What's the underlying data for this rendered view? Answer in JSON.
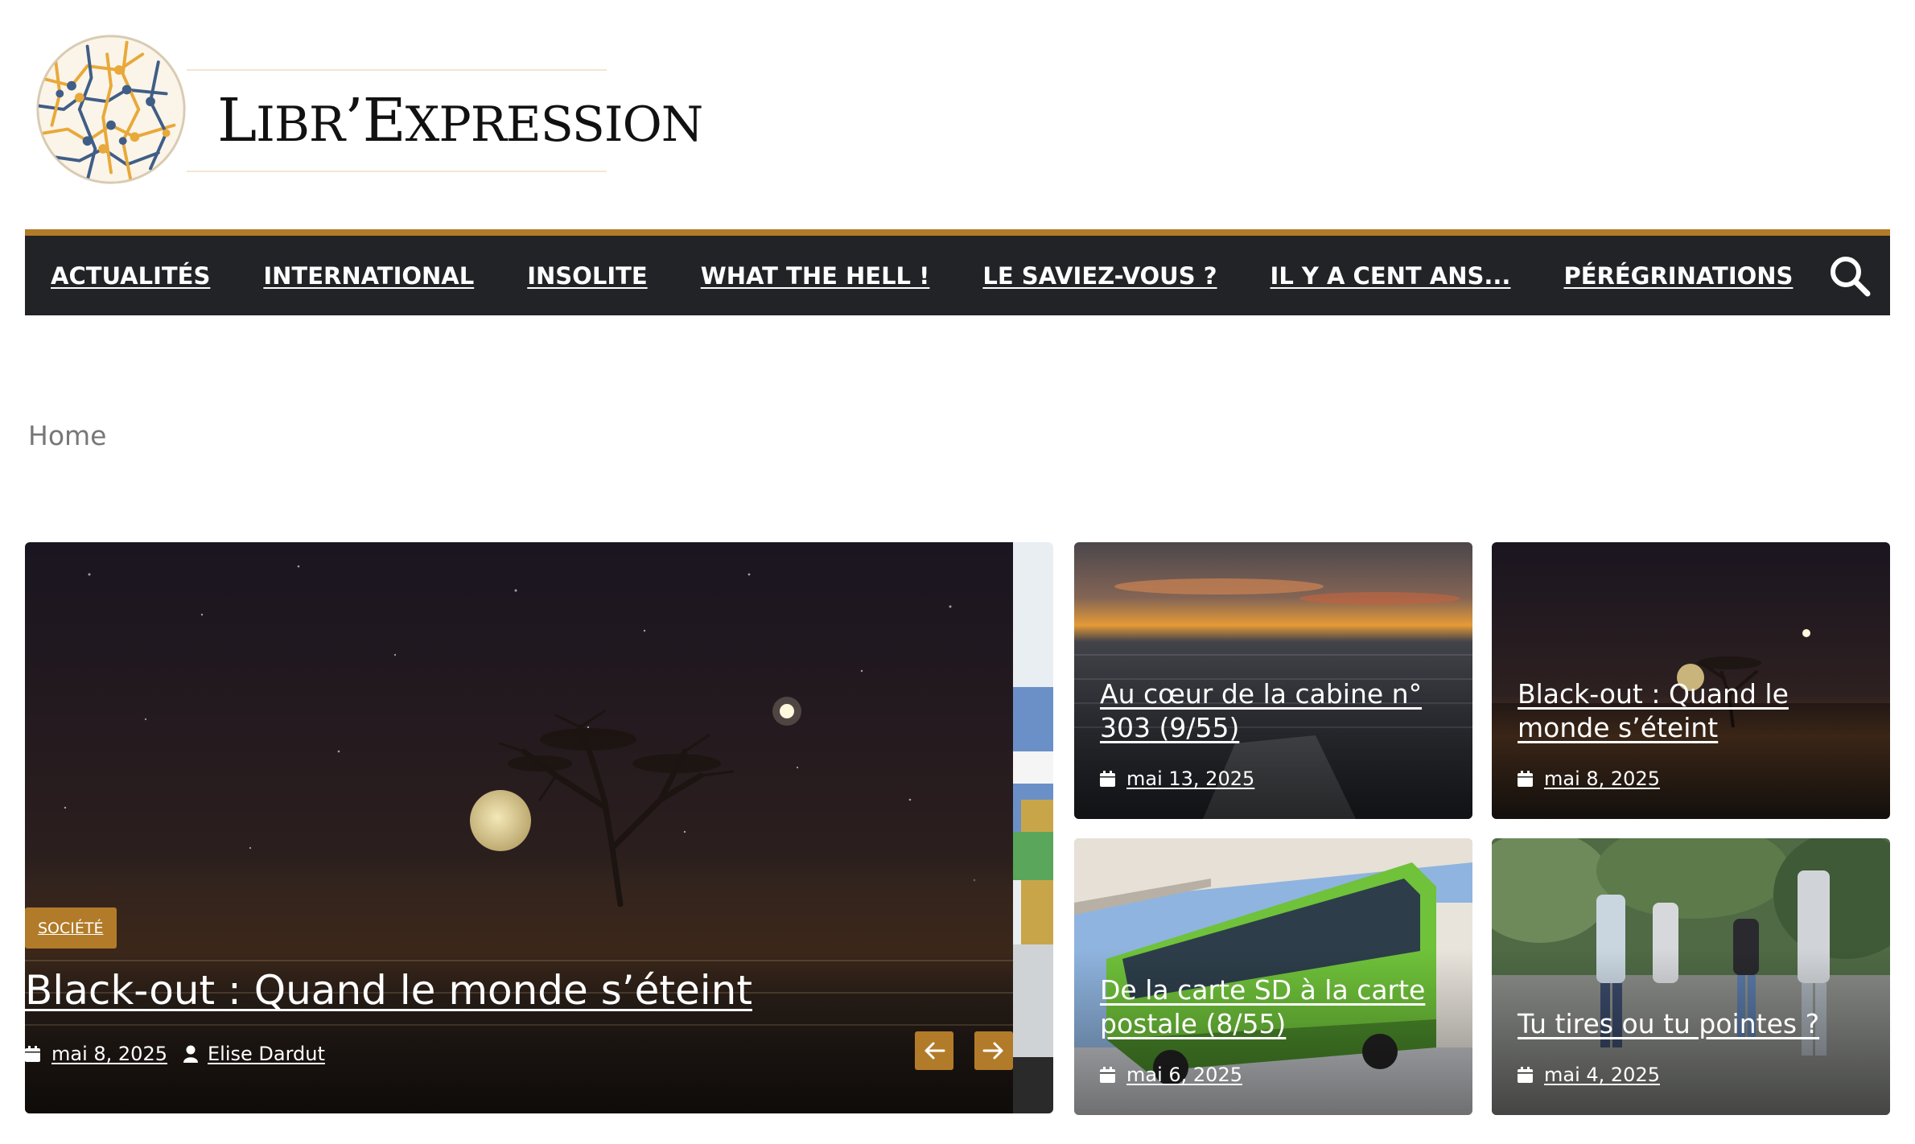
{
  "site": {
    "logo_text": "Libr’Expression",
    "brand_color": "#b27b29",
    "nav_bg": "#222327"
  },
  "nav": {
    "items": [
      {
        "label": "ACTUALITÉS"
      },
      {
        "label": "INTERNATIONAL"
      },
      {
        "label": "INSOLITE"
      },
      {
        "label": "WHAT THE HELL !"
      },
      {
        "label": "LE SAVIEZ-VOUS ?"
      },
      {
        "label": "IL Y A CENT ANS..."
      },
      {
        "label": "PÉRÉGRINATIONS"
      }
    ],
    "search_icon": "search-icon"
  },
  "breadcrumb": {
    "home": "Home"
  },
  "slider": {
    "category": "SOCIÉTÉ",
    "title": "Black-out : Quand le monde s’éteint",
    "date": "mai 8, 2025",
    "author": "Elise Dardut",
    "prev_icon": "arrow-left-icon",
    "next_icon": "arrow-right-icon"
  },
  "cards": [
    {
      "title": "Au cœur de la cabine n° 303 (9/55)",
      "date": "mai 13, 2025"
    },
    {
      "title": "Black-out : Quand le monde s’éteint",
      "date": "mai 8, 2025"
    },
    {
      "title": "De la carte SD à la carte postale (8/55)",
      "date": "mai 6, 2025"
    },
    {
      "title": "Tu tires ou tu pointes ?",
      "date": "mai 4, 2025"
    }
  ]
}
